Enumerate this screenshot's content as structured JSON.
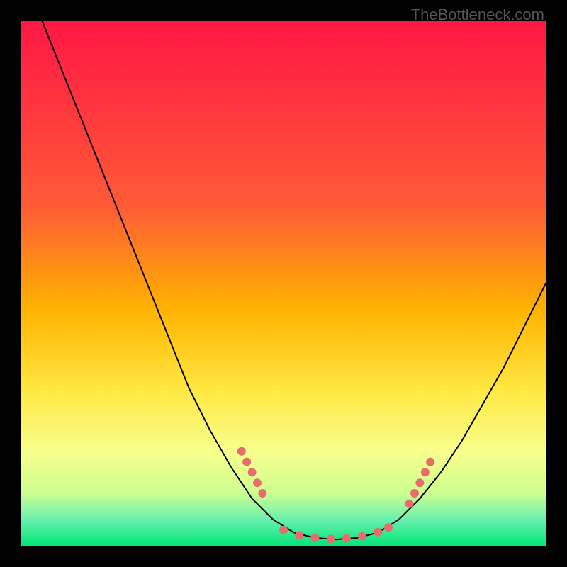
{
  "watermark": "TheBottleneck.com",
  "chart_data": {
    "type": "line",
    "title": "",
    "xlabel": "",
    "ylabel": "",
    "xlim": [
      0,
      100
    ],
    "ylim": [
      0,
      100
    ],
    "background_gradient": {
      "stops": [
        {
          "offset": 0,
          "color": "#ff1744"
        },
        {
          "offset": 35,
          "color": "#ff5a36"
        },
        {
          "offset": 55,
          "color": "#ffb300"
        },
        {
          "offset": 70,
          "color": "#ffe740"
        },
        {
          "offset": 82,
          "color": "#f8ff8c"
        },
        {
          "offset": 90,
          "color": "#ccff90"
        },
        {
          "offset": 95,
          "color": "#69f0ae"
        },
        {
          "offset": 100,
          "color": "#00e676"
        }
      ]
    },
    "series": [
      {
        "name": "bottleneck-curve",
        "type": "line",
        "color": "#000000",
        "points": [
          {
            "x": 4,
            "y": 100
          },
          {
            "x": 8,
            "y": 90
          },
          {
            "x": 12,
            "y": 80
          },
          {
            "x": 16,
            "y": 70
          },
          {
            "x": 20,
            "y": 60
          },
          {
            "x": 24,
            "y": 50
          },
          {
            "x": 28,
            "y": 40
          },
          {
            "x": 32,
            "y": 30
          },
          {
            "x": 36,
            "y": 22
          },
          {
            "x": 40,
            "y": 15
          },
          {
            "x": 44,
            "y": 9
          },
          {
            "x": 48,
            "y": 5
          },
          {
            "x": 52,
            "y": 2.5
          },
          {
            "x": 56,
            "y": 1.5
          },
          {
            "x": 60,
            "y": 1.2
          },
          {
            "x": 64,
            "y": 1.5
          },
          {
            "x": 68,
            "y": 2.5
          },
          {
            "x": 72,
            "y": 5
          },
          {
            "x": 76,
            "y": 9
          },
          {
            "x": 80,
            "y": 14
          },
          {
            "x": 84,
            "y": 20
          },
          {
            "x": 88,
            "y": 27
          },
          {
            "x": 92,
            "y": 34
          },
          {
            "x": 96,
            "y": 42
          },
          {
            "x": 100,
            "y": 50
          }
        ]
      },
      {
        "name": "highlight-dots",
        "type": "scatter",
        "color": "#e86c6c",
        "points": [
          {
            "x": 42,
            "y": 18
          },
          {
            "x": 43,
            "y": 16
          },
          {
            "x": 44,
            "y": 14
          },
          {
            "x": 45,
            "y": 12
          },
          {
            "x": 46,
            "y": 10
          },
          {
            "x": 50,
            "y": 3
          },
          {
            "x": 53,
            "y": 2
          },
          {
            "x": 56,
            "y": 1.5
          },
          {
            "x": 59,
            "y": 1.3
          },
          {
            "x": 62,
            "y": 1.4
          },
          {
            "x": 65,
            "y": 1.8
          },
          {
            "x": 68,
            "y": 2.6
          },
          {
            "x": 70,
            "y": 3.5
          },
          {
            "x": 74,
            "y": 8
          },
          {
            "x": 75,
            "y": 10
          },
          {
            "x": 76,
            "y": 12
          },
          {
            "x": 77,
            "y": 14
          },
          {
            "x": 78,
            "y": 16
          }
        ]
      }
    ]
  }
}
